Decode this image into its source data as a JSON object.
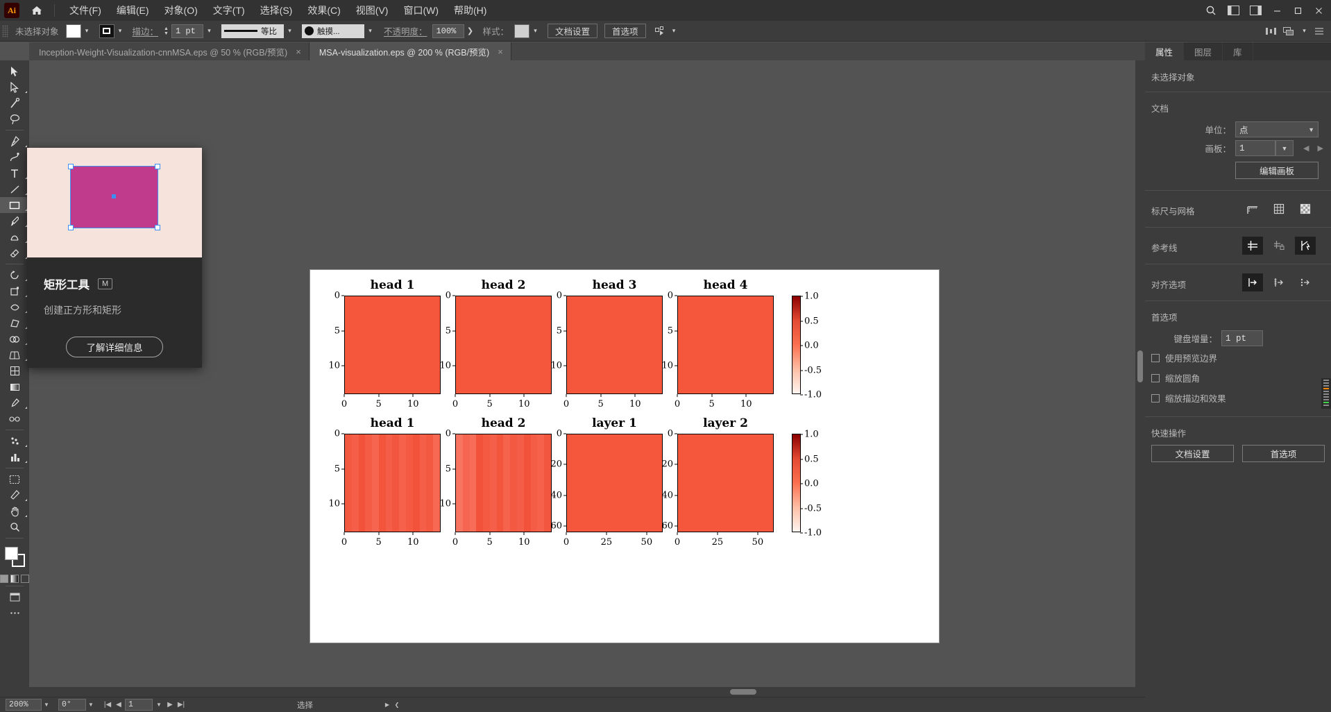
{
  "app": {
    "name": "Ai",
    "logo_text": "Ai"
  },
  "menubar": {
    "home_icon": "home-icon",
    "items": [
      {
        "label": "文件(F)",
        "name": "menu-file"
      },
      {
        "label": "编辑(E)",
        "name": "menu-edit"
      },
      {
        "label": "对象(O)",
        "name": "menu-object"
      },
      {
        "label": "文字(T)",
        "name": "menu-type"
      },
      {
        "label": "选择(S)",
        "name": "menu-select"
      },
      {
        "label": "效果(C)",
        "name": "menu-effect"
      },
      {
        "label": "视图(V)",
        "name": "menu-view"
      },
      {
        "label": "窗口(W)",
        "name": "menu-window"
      },
      {
        "label": "帮助(H)",
        "name": "menu-help"
      }
    ],
    "right_icons": [
      "search-icon",
      "arrange-documents-icon",
      "workspace-switcher-icon"
    ],
    "window_controls": [
      "minimize",
      "maximize",
      "close"
    ]
  },
  "controlbar": {
    "selection_status": "未选择对象",
    "fill_label": "fill-swatch",
    "stroke_label": "stroke-swatch",
    "stroke_text": "描边：",
    "stroke_weight": "1 pt",
    "stroke_profile": "等比",
    "brush_label": "触摸...",
    "opacity_label": "不透明度：",
    "opacity_value": "100%",
    "style_label": "样式：",
    "doc_setup_button": "文档设置",
    "preferences_button": "首选项",
    "select_similar_icon": "select-similar-icon"
  },
  "tabs": [
    {
      "title": "Inception-Weight-Visualization-cnnMSA.eps @ 50 % (RGB/预览)",
      "active": false
    },
    {
      "title": "MSA-visualization.eps @ 200 % (RGB/预览)",
      "active": true
    }
  ],
  "toolbar": {
    "tools": [
      {
        "name": "selection-tool",
        "selected": false
      },
      {
        "name": "direct-selection-tool",
        "selected": false
      },
      {
        "name": "magic-wand-tool",
        "selected": false
      },
      {
        "name": "lasso-tool",
        "selected": false
      },
      {
        "name": "pen-tool",
        "selected": false
      },
      {
        "name": "curvature-tool",
        "selected": false
      },
      {
        "name": "type-tool",
        "selected": false
      },
      {
        "name": "line-segment-tool",
        "selected": false
      },
      {
        "name": "rectangle-tool",
        "selected": true
      },
      {
        "name": "paintbrush-tool",
        "selected": false
      },
      {
        "name": "shaper-tool",
        "selected": false
      },
      {
        "name": "eraser-tool",
        "selected": false
      },
      {
        "name": "rotate-tool",
        "selected": false
      },
      {
        "name": "scale-tool",
        "selected": false
      },
      {
        "name": "width-tool",
        "selected": false
      },
      {
        "name": "free-transform-tool",
        "selected": false
      },
      {
        "name": "shape-builder-tool",
        "selected": false
      },
      {
        "name": "perspective-grid-tool",
        "selected": false
      },
      {
        "name": "mesh-tool",
        "selected": false
      },
      {
        "name": "gradient-tool",
        "selected": false
      },
      {
        "name": "eyedropper-tool",
        "selected": false
      },
      {
        "name": "blend-tool",
        "selected": false
      },
      {
        "name": "symbol-sprayer-tool",
        "selected": false
      },
      {
        "name": "column-graph-tool",
        "selected": false
      },
      {
        "name": "artboard-tool",
        "selected": false
      },
      {
        "name": "slice-tool",
        "selected": false
      },
      {
        "name": "hand-tool",
        "selected": false
      },
      {
        "name": "zoom-tool",
        "selected": false
      },
      {
        "name": "edit-toolbar-button",
        "selected": false
      }
    ]
  },
  "tooltip": {
    "title": "矩形工具",
    "shortcut": "M",
    "description": "创建正方形和矩形",
    "button": "了解详细信息",
    "preview_bg": "#f6e3dc",
    "preview_shape_color": "#c13b8c",
    "preview_handle_color": "#3b8ff5"
  },
  "rightpanel": {
    "tabs": [
      {
        "label": "属性",
        "active": true
      },
      {
        "label": "图层",
        "active": false
      },
      {
        "label": "库",
        "active": false
      }
    ],
    "status": "未选择对象",
    "document": {
      "section": "文档",
      "unit_label": "单位：",
      "unit_value": "点",
      "artboard_label": "画板：",
      "artboard_value": "1",
      "edit_artboards_button": "编辑画板"
    },
    "rulers": {
      "section": "标尺与网格",
      "icons": [
        "rulers-icon",
        "grid-icon",
        "transparency-grid-icon"
      ]
    },
    "guides": {
      "section": "参考线",
      "icons": [
        "show-guides-icon",
        "lock-guides-icon",
        "smart-guides-icon"
      ]
    },
    "align": {
      "section": "对齐选项",
      "icons": [
        "align-to-pixel-grid-icon",
        "snap-to-grid-icon",
        "snap-to-point-icon"
      ]
    },
    "preferences": {
      "section": "首选项",
      "keyboard_increment_label": "键盘增量：",
      "keyboard_increment_value": "1 pt",
      "checkboxes": [
        {
          "label": "使用预览边界",
          "checked": false
        },
        {
          "label": "缩放圆角",
          "checked": false
        },
        {
          "label": "缩放描边和效果",
          "checked": false
        }
      ]
    },
    "quick_actions": {
      "section": "快速操作",
      "buttons": [
        "文档设置",
        "首选项"
      ]
    }
  },
  "statusbar": {
    "zoom": "200%",
    "rotation": "0°",
    "page": "1",
    "tool_status": "选择",
    "nav_icons": [
      "first-page-icon",
      "prev-page-icon",
      "next-page-icon",
      "last-page-icon"
    ]
  },
  "chart_data": {
    "type": "heatmap",
    "title": "",
    "colormap": "Reds_r",
    "cbar_ticks": [
      "1.0",
      "0.5",
      "0.0",
      "-0.5",
      "-1.0"
    ],
    "cbar_range": [
      -1.0,
      1.0
    ],
    "cbar_colors": [
      "#8b0000",
      "#e34a33",
      "#fb7050",
      "#fdbea5",
      "#fff5f0"
    ],
    "panels": [
      {
        "title": "head 1",
        "row": 0,
        "col": 0,
        "xticks": [
          "0",
          "5",
          "10"
        ],
        "yticks": [
          "0",
          "5",
          "10"
        ],
        "xrange": [
          0,
          14
        ],
        "yrange": [
          0,
          14
        ],
        "base_color": "#f4573c",
        "cells": []
      },
      {
        "title": "head 2",
        "row": 0,
        "col": 1,
        "xticks": [
          "0",
          "5",
          "10"
        ],
        "yticks": [
          "0",
          "5",
          "10"
        ],
        "xrange": [
          0,
          14
        ],
        "yrange": [
          0,
          14
        ],
        "base_color": "#f4573c",
        "cells": []
      },
      {
        "title": "head 3",
        "row": 0,
        "col": 2,
        "xticks": [
          "0",
          "5",
          "10"
        ],
        "yticks": [
          "0",
          "5",
          "10"
        ],
        "xrange": [
          0,
          14
        ],
        "yrange": [
          0,
          14
        ],
        "base_color": "#f4573c",
        "cells": []
      },
      {
        "title": "head 4",
        "row": 0,
        "col": 3,
        "xticks": [
          "0",
          "5",
          "10"
        ],
        "yticks": [
          "0",
          "5",
          "10"
        ],
        "xrange": [
          0,
          14
        ],
        "yrange": [
          0,
          14
        ],
        "base_color": "#f4573c",
        "cells": []
      },
      {
        "title": "head 1",
        "row": 1,
        "col": 0,
        "xticks": [
          "0",
          "5",
          "10"
        ],
        "yticks": [
          "0",
          "5",
          "10"
        ],
        "xrange": [
          0,
          14
        ],
        "yrange": [
          0,
          14
        ],
        "base_color": "#f65c42",
        "columns": [
          0.97,
          0.93,
          1.0,
          0.95,
          0.9,
          0.99,
          0.94,
          0.98,
          0.92,
          0.96,
          1.0,
          0.93,
          0.97,
          0.88
        ]
      },
      {
        "title": "head 2",
        "row": 1,
        "col": 1,
        "xticks": [
          "0",
          "5",
          "10"
        ],
        "yticks": [
          "0",
          "5",
          "10"
        ],
        "xrange": [
          0,
          14
        ],
        "yrange": [
          0,
          14
        ],
        "base_color": "#f65c42",
        "columns": [
          0.82,
          0.9,
          0.86,
          1.0,
          0.96,
          0.93,
          0.99,
          0.91,
          0.97,
          0.94,
          1.0,
          0.95,
          0.92,
          0.98
        ]
      },
      {
        "title": "layer 1",
        "row": 1,
        "col": 2,
        "xticks": [
          "0",
          "25",
          "50"
        ],
        "yticks": [
          "0",
          "20",
          "40",
          "60"
        ],
        "xrange": [
          0,
          60
        ],
        "yrange": [
          0,
          64
        ],
        "base_color": "#f4573c",
        "columns": []
      },
      {
        "title": "layer 2",
        "row": 1,
        "col": 3,
        "xticks": [
          "0",
          "25",
          "50"
        ],
        "yticks": [
          "0",
          "20",
          "40",
          "60"
        ],
        "xrange": [
          0,
          60
        ],
        "yrange": [
          0,
          64
        ],
        "base_color": "#f4573c",
        "columns": []
      }
    ]
  }
}
